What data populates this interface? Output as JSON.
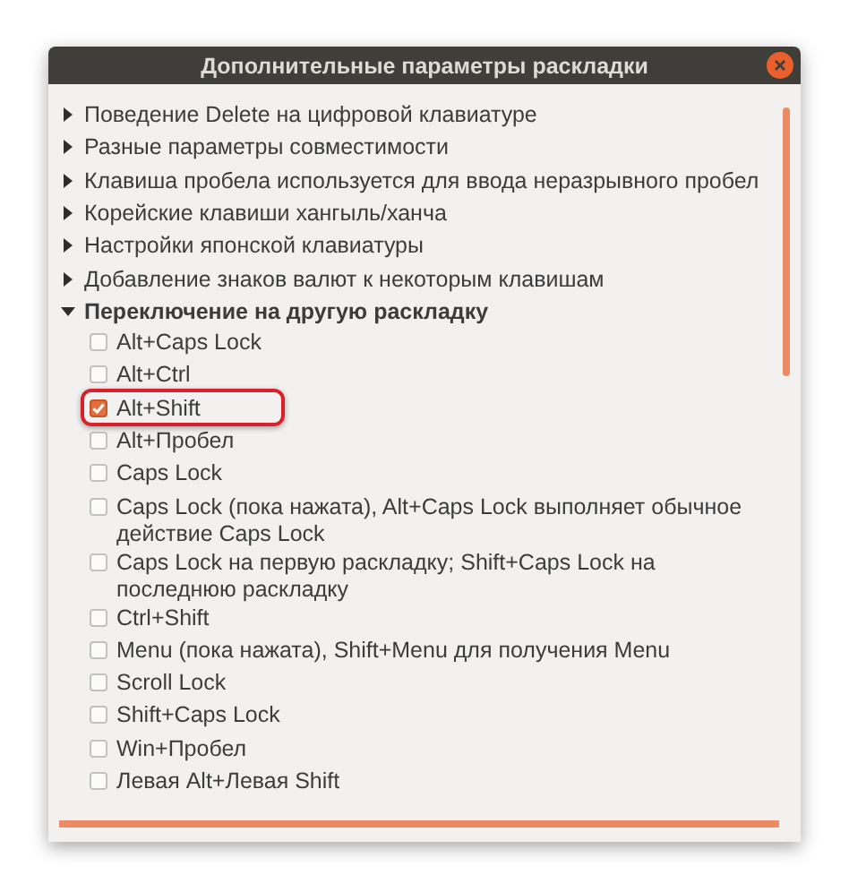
{
  "window": {
    "title": "Дополнительные параметры раскладки"
  },
  "groups": [
    {
      "label": "Поведение Delete на цифровой клавиатуре",
      "expanded": false
    },
    {
      "label": "Разные параметры совместимости",
      "expanded": false
    },
    {
      "label": "Клавиша пробела используется для ввода неразрывного пробел",
      "expanded": false
    },
    {
      "label": "Корейские клавиши хангыль/ханча",
      "expanded": false
    },
    {
      "label": "Настройки японской клавиатуры",
      "expanded": false
    },
    {
      "label": "Добавление знаков валют к некоторым клавишам",
      "expanded": false
    },
    {
      "label": "Переключение на другую раскладку",
      "expanded": true,
      "children": [
        {
          "label": "Alt+Caps Lock",
          "checked": false,
          "highlighted": false
        },
        {
          "label": "Alt+Ctrl",
          "checked": false,
          "highlighted": false
        },
        {
          "label": "Alt+Shift",
          "checked": true,
          "highlighted": true
        },
        {
          "label": "Alt+Пробел",
          "checked": false,
          "highlighted": false
        },
        {
          "label": "Caps Lock",
          "checked": false,
          "highlighted": false
        },
        {
          "label": "Caps Lock (пока нажата), Alt+Caps Lock выполняет обычное действие Caps Lock",
          "checked": false,
          "highlighted": false
        },
        {
          "label": "Caps Lock на первую раскладку; Shift+Caps Lock на последнюю раскладку",
          "checked": false,
          "highlighted": false
        },
        {
          "label": "Ctrl+Shift",
          "checked": false,
          "highlighted": false
        },
        {
          "label": "Menu (пока нажата), Shift+Menu для получения Menu",
          "checked": false,
          "highlighted": false
        },
        {
          "label": "Scroll Lock",
          "checked": false,
          "highlighted": false
        },
        {
          "label": "Shift+Caps Lock",
          "checked": false,
          "highlighted": false
        },
        {
          "label": "Win+Пробел",
          "checked": false,
          "highlighted": false
        },
        {
          "label": "Левая Alt+Левая Shift",
          "checked": false,
          "highlighted": false
        }
      ]
    }
  ]
}
